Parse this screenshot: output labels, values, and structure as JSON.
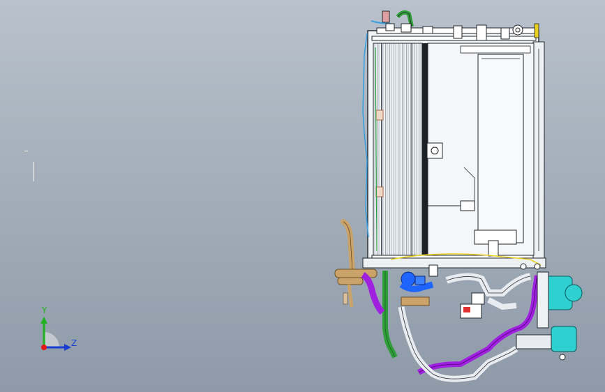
{
  "viewport": {
    "background_top": "#b9c2cc",
    "background_bottom": "#8e9aa8"
  },
  "model": {
    "name_icon": "radiator-cooling-module-assembly",
    "colors": {
      "frame": "#f2f4f6",
      "outline": "#20242a",
      "hose_purple": "#a020e0",
      "hose_white": "#e8ecf0",
      "hose_green": "#2f9e3a",
      "pipe_tan": "#c9a36a",
      "pump_cyan": "#2fd0d0",
      "valve_blue": "#1e64ff",
      "wire_yellow": "#e8d020"
    }
  },
  "triad": {
    "y_label": "Y",
    "z_label": "Z",
    "y_color": "#20b020",
    "z_color": "#1a3fd0",
    "x_color": "#e01818"
  }
}
